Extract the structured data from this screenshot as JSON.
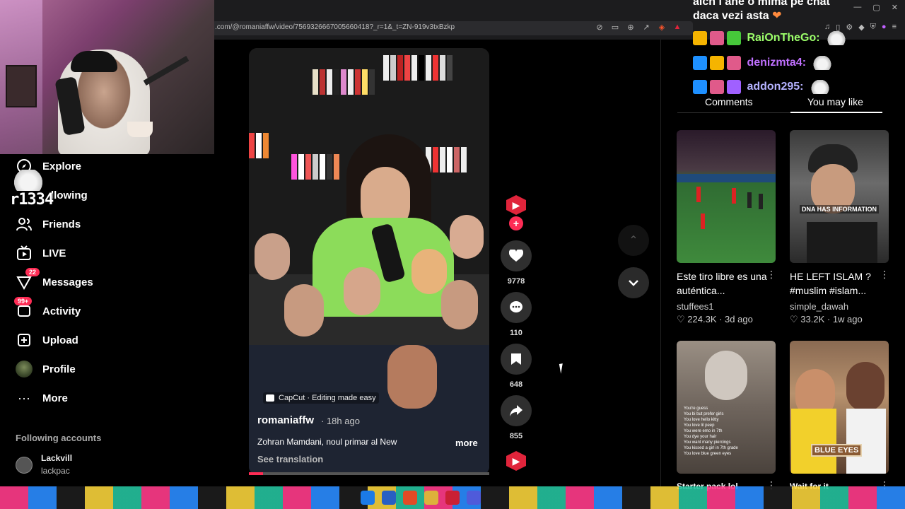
{
  "browser": {
    "url": "tiktok.com/@romaniaffw/video/7569326667005660418?_r=1&_t=ZN-919v3txBzkp",
    "url_visible": ".com/@romaniaffw/video/7569326667005660418?_r=1&_t=ZN-919v3txBzkp"
  },
  "sidebar": {
    "items": [
      {
        "label": "Explore",
        "icon": "compass-icon"
      },
      {
        "label": "Following",
        "label_visible": "llowing",
        "icon": "following-icon"
      },
      {
        "label": "Friends",
        "icon": "friends-icon"
      },
      {
        "label": "LIVE",
        "icon": "live-icon"
      },
      {
        "label": "Messages",
        "icon": "messages-icon",
        "badge": "22"
      },
      {
        "label": "Activity",
        "icon": "activity-icon",
        "badge": "99+"
      },
      {
        "label": "Upload",
        "icon": "upload-icon"
      },
      {
        "label": "Profile",
        "icon": "avatar-icon"
      },
      {
        "label": "More",
        "icon": "more-icon"
      }
    ],
    "sticker_text": "r1334",
    "following_accounts_title": "Following accounts",
    "accounts": [
      {
        "name": "Lackvill",
        "handle": "lackpac"
      }
    ]
  },
  "video": {
    "capcut_label": "CapCut · Editing made easy",
    "author": "romaniaffw",
    "time": "· 18h ago",
    "caption": "Zohran Mamdani, noul primar al New",
    "more": "more",
    "see_translation": "See translation",
    "progress": 0.06,
    "likes": "9778",
    "comments": "110",
    "saves": "648",
    "shares": "855"
  },
  "chat": {
    "top_line_1": "aich i ane o mima pe chat",
    "top_line_2": "daca vezi asta",
    "messages": [
      {
        "user": "RaiOnTheGo:",
        "color": "#9cff6a"
      },
      {
        "user": "denizmta4:",
        "color": "#c070ff"
      },
      {
        "user": "addon295:",
        "color": "#b5b2ff"
      }
    ]
  },
  "tabs": {
    "comments": "Comments",
    "you_may_like": "You may like"
  },
  "cards": [
    {
      "title": "Este tiro libre es una auténtica...",
      "author": "stuffees1",
      "likes": "224.3K",
      "age": "3d ago"
    },
    {
      "title": "HE LEFT ISLAM ? #muslim #islam...",
      "author": "simple_dawah",
      "likes": "33.2K",
      "age": "1w ago",
      "overlay": "DNA HAS INFORMATION"
    },
    {
      "title_partial": "Starter pack lol",
      "overlay_lines": [
        "You're guess",
        "You bi but prefer girls",
        "You love hello kitty",
        "You love lil peep",
        "You were emo in 7th",
        "You dye your hair",
        "You want many piercings",
        "You kissed a girl in 7th grade",
        "You love blue green eyes"
      ]
    },
    {
      "title_partial": "Wait for it",
      "overlay": "BLUE EYES"
    }
  ],
  "colors": {
    "accent": "#fe2c55",
    "bg": "#000000"
  }
}
